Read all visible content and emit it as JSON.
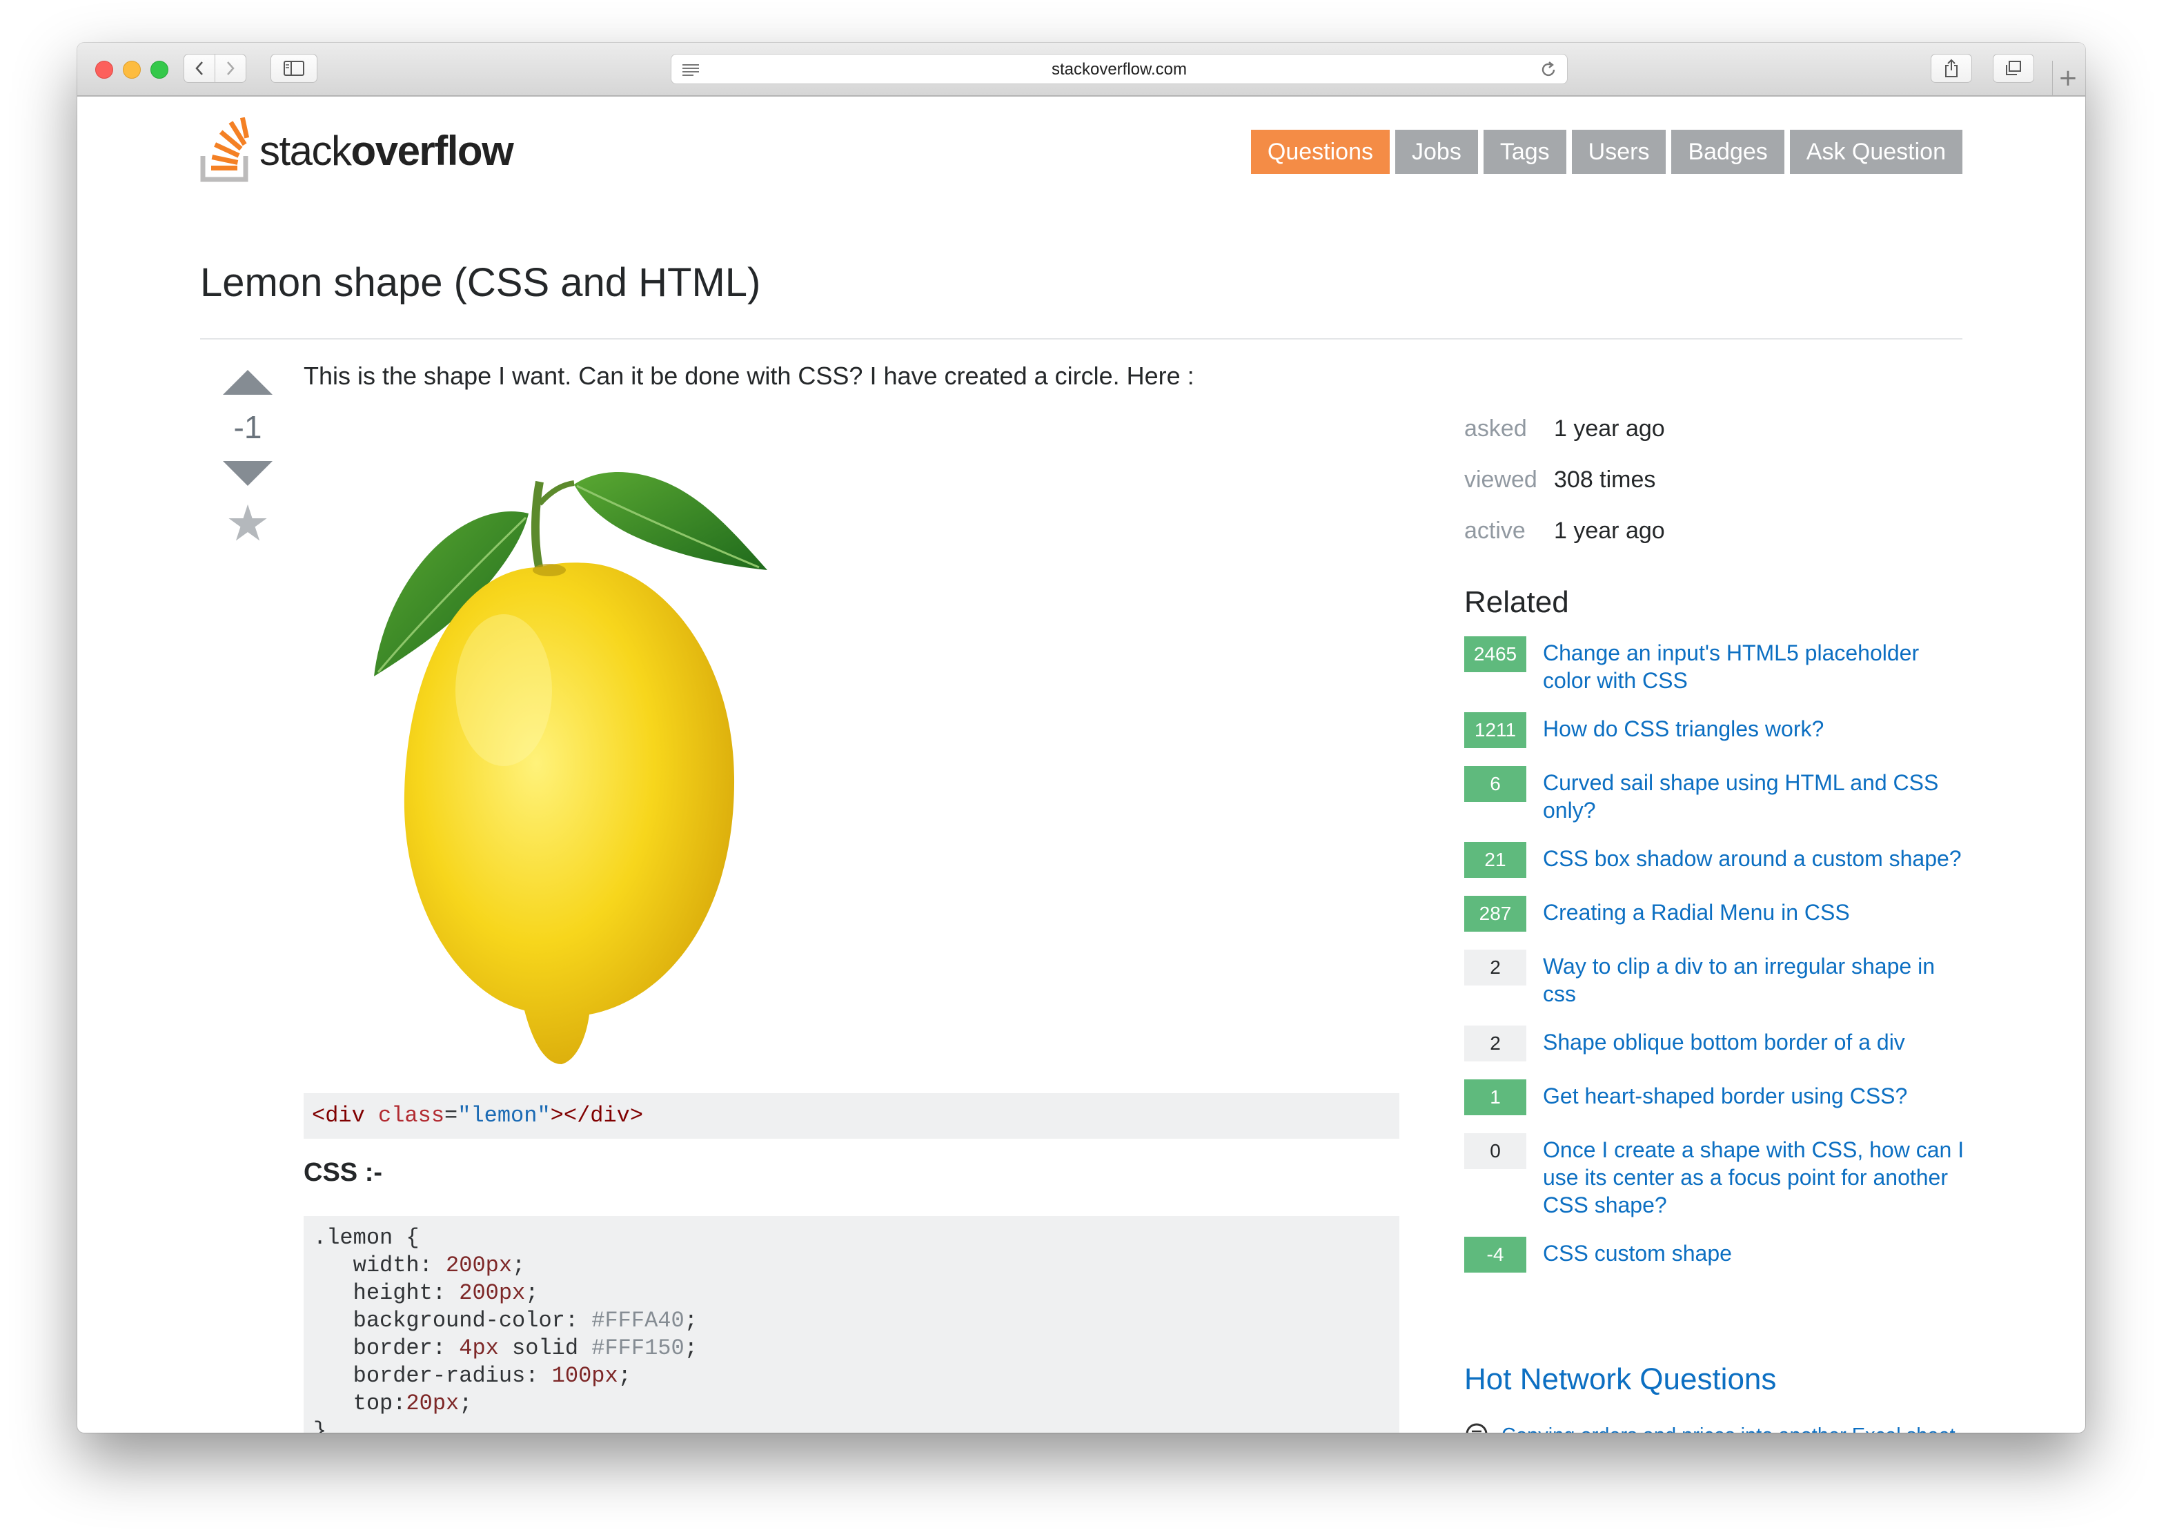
{
  "browser": {
    "url": "stackoverflow.com",
    "new_tab_label": "+"
  },
  "site": {
    "logo_light": "stack",
    "logo_bold": "overflow"
  },
  "nav": {
    "items": [
      "Questions",
      "Jobs",
      "Tags",
      "Users",
      "Badges",
      "Ask Question"
    ],
    "active": "Questions"
  },
  "question": {
    "title": "Lemon shape (CSS and HTML)",
    "votes": "-1",
    "body": "This is the shape I want. Can it be done with CSS? I have created a circle. Here :",
    "html_code": {
      "open_tag": "<div",
      "attr": "class",
      "eq": "=",
      "value": "\"lemon\"",
      "close": "></div>"
    },
    "css_heading": "CSS :-",
    "css_code": [
      {
        "text": ".lemon {"
      },
      {
        "prop": "   width: ",
        "num": "200px",
        "end": ";"
      },
      {
        "prop": "   height: ",
        "num": "200px",
        "end": ";"
      },
      {
        "prop": "   background-color: ",
        "hex": "#FFFA40",
        "end": ";"
      },
      {
        "prop": "   border: ",
        "num": "4px",
        "mid": " solid ",
        "hex": "#FFF150",
        "end": ";"
      },
      {
        "prop": "   border-radius: ",
        "num": "100px",
        "end": ";"
      },
      {
        "prop": "   top:",
        "num": "20px",
        "end": ";"
      },
      {
        "text": "}"
      }
    ]
  },
  "meta": [
    {
      "label": "asked",
      "value": "1 year ago"
    },
    {
      "label": "viewed",
      "value": "308 times"
    },
    {
      "label": "active",
      "value": "1 year ago"
    }
  ],
  "related": {
    "title": "Related",
    "items": [
      {
        "score": "2465",
        "accepted": true,
        "title": "Change an input's HTML5 placeholder color with CSS"
      },
      {
        "score": "1211",
        "accepted": true,
        "title": "How do CSS triangles work?"
      },
      {
        "score": "6",
        "accepted": true,
        "title": "Curved sail shape using HTML and CSS only?"
      },
      {
        "score": "21",
        "accepted": true,
        "title": "CSS box shadow around a custom shape?"
      },
      {
        "score": "287",
        "accepted": true,
        "title": "Creating a Radial Menu in CSS"
      },
      {
        "score": "2",
        "accepted": false,
        "title": "Way to clip a div to an irregular shape in css"
      },
      {
        "score": "2",
        "accepted": false,
        "title": "Shape oblique bottom border of a div"
      },
      {
        "score": "1",
        "accepted": true,
        "title": "Get heart-shaped border using CSS?"
      },
      {
        "score": "0",
        "accepted": false,
        "title": "Once I create a shape with CSS, how can I use its center as a focus point for another CSS shape?"
      },
      {
        "score": "-4",
        "accepted": true,
        "title": "CSS custom shape"
      }
    ]
  },
  "hot": {
    "title": "Hot Network Questions",
    "items": [
      {
        "title": "Copying orders and prices into another Excel sheet",
        "icon": "superuser-icon"
      }
    ]
  },
  "colors": {
    "accent": "#f48c46",
    "link": "#0c6fc2",
    "accepted": "#5fba7d"
  }
}
